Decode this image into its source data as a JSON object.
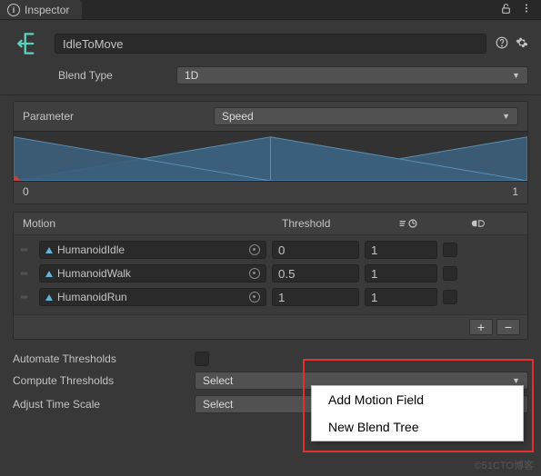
{
  "tab": {
    "title": "Inspector"
  },
  "blendTree": {
    "name": "IdleToMove",
    "blendTypeLabel": "Blend Type",
    "blendType": "1D",
    "parameterLabel": "Parameter",
    "parameter": "Speed",
    "axisMin": "0",
    "axisMax": "1"
  },
  "motionTable": {
    "headers": {
      "motion": "Motion",
      "threshold": "Threshold"
    },
    "rows": [
      {
        "clip": "HumanoidIdle",
        "threshold": "0",
        "speed": "1"
      },
      {
        "clip": "HumanoidWalk",
        "threshold": "0.5",
        "speed": "1"
      },
      {
        "clip": "HumanoidRun",
        "threshold": "1",
        "speed": "1"
      }
    ]
  },
  "options": {
    "automateThresholdsLabel": "Automate Thresholds",
    "computeThresholdsLabel": "Compute Thresholds",
    "computeThresholds": "Select",
    "adjustTimeScaleLabel": "Adjust Time Scale",
    "adjustTimeScale": "Select"
  },
  "contextMenu": {
    "addMotionField": "Add Motion Field",
    "newBlendTree": "New Blend Tree"
  },
  "watermark": "©51CTO博客"
}
